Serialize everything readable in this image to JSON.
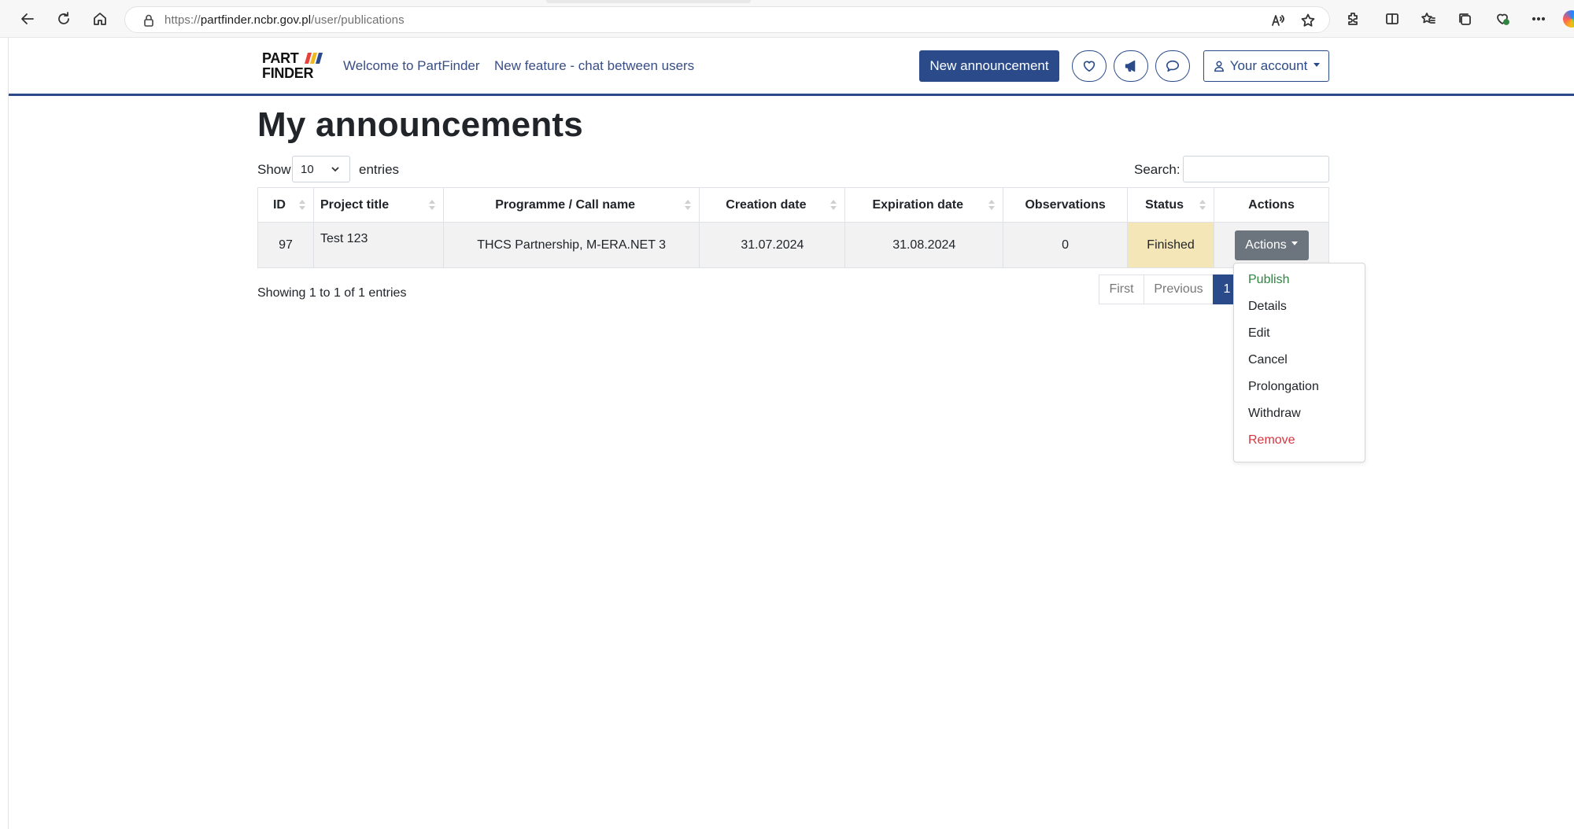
{
  "browser": {
    "url_prefix": "https://",
    "url_host": "partfinder.ncbr.gov.pl",
    "url_path": "/user/publications",
    "icons": [
      "back-icon",
      "refresh-icon",
      "home-icon",
      "lock-icon",
      "read-aloud-icon",
      "favorite-star-icon",
      "extensions-icon",
      "split-screen-icon",
      "favorites-icon",
      "collections-icon",
      "browser-essentials-icon",
      "more-icon",
      "copilot-icon"
    ]
  },
  "header": {
    "logo_line1": "PART",
    "logo_line2": "FINDER",
    "nav": [
      "Welcome to PartFinder",
      "New feature - chat between users"
    ],
    "new_announcement": "New announcement",
    "account": "Your account",
    "icons": [
      "heart-icon",
      "megaphone-icon",
      "chat-icon",
      "user-icon"
    ],
    "brand_color": "#2a4a8a"
  },
  "main": {
    "title": "My announcements",
    "show_label": "Show",
    "entries_value": "10",
    "entries_label": "entries",
    "search_label": "Search:",
    "search_value": ""
  },
  "table": {
    "headers": {
      "id": "ID",
      "title": "Project title",
      "programme": "Programme / Call name",
      "created": "Creation date",
      "expires": "Expiration date",
      "observations": "Observations",
      "status": "Status",
      "actions": "Actions"
    },
    "rows": [
      {
        "id": "97",
        "title": "Test 123",
        "programme": "THCS Partnership, M-ERA.NET 3",
        "created": "31.07.2024",
        "expires": "31.08.2024",
        "observations": "0",
        "status": "Finished",
        "actions_label": "Actions"
      }
    ],
    "status_color": "#f5e6b8"
  },
  "footer": {
    "info": "Showing 1 to 1 of 1 entries",
    "pagination": {
      "first": "First",
      "previous": "Previous",
      "current": "1"
    }
  },
  "menu": {
    "items": [
      {
        "label": "Publish",
        "color": "#2e8540"
      },
      {
        "label": "Details",
        "color": "#212529"
      },
      {
        "label": "Edit",
        "color": "#212529"
      },
      {
        "label": "Cancel",
        "color": "#212529"
      },
      {
        "label": "Prolongation",
        "color": "#212529"
      },
      {
        "label": "Withdraw",
        "color": "#212529"
      },
      {
        "label": "Remove",
        "color": "#d9343f"
      }
    ]
  }
}
